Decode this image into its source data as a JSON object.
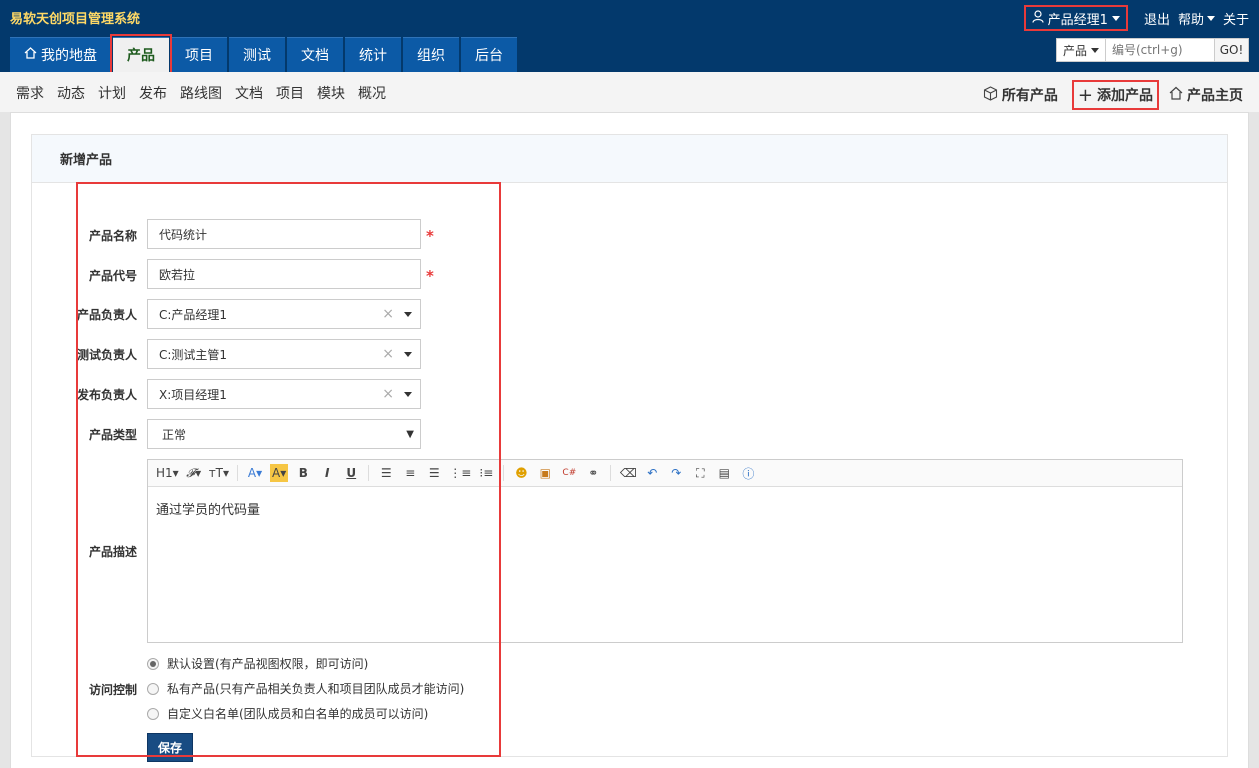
{
  "app": {
    "title": "易软天创项目管理系统"
  },
  "topnav": {
    "user": "产品经理1",
    "logout": "退出",
    "help": "帮助",
    "about": "关于"
  },
  "tabs": [
    {
      "label": "我的地盘",
      "icon": "home-icon"
    },
    {
      "label": "产品"
    },
    {
      "label": "项目"
    },
    {
      "label": "测试"
    },
    {
      "label": "文档"
    },
    {
      "label": "统计"
    },
    {
      "label": "组织"
    },
    {
      "label": "后台"
    }
  ],
  "search": {
    "scope": "产品",
    "placeholder": "编号(ctrl+g)",
    "go": "GO!"
  },
  "subnav": {
    "items": [
      "需求",
      "动态",
      "计划",
      "发布",
      "路线图",
      "文档",
      "项目",
      "模块",
      "概况"
    ],
    "all_products": "所有产品",
    "add_product": "添加产品",
    "product_home": "产品主页"
  },
  "form": {
    "title": "新增产品",
    "name_label": "产品名称",
    "name_value": "代码统计",
    "code_label": "产品代号",
    "code_value": "欧若拉",
    "po_label": "产品负责人",
    "po_value": "C:产品经理1",
    "qd_label": "测试负责人",
    "qd_value": "C:测试主管1",
    "rd_label": "发布负责人",
    "rd_value": "X:项目经理1",
    "type_label": "产品类型",
    "type_value": "正常",
    "desc_label": "产品描述",
    "desc_value": "通过学员的代码量",
    "acl_label": "访问控制",
    "acl_options": [
      "默认设置(有产品视图权限，即可访问)",
      "私有产品(只有产品相关负责人和项目团队成员才能访问)",
      "自定义白名单(团队成员和白名单的成员可以访问)"
    ],
    "acl_selected": 0,
    "save": "保存"
  },
  "toolbar_icons": [
    "heading-icon",
    "font-family-icon",
    "font-size-icon",
    "font-color-icon",
    "highlight-icon",
    "bold-icon",
    "italic-icon",
    "underline-icon",
    "align-left-icon",
    "align-center-icon",
    "align-right-icon",
    "ordered-list-icon",
    "unordered-list-icon",
    "emoticon-icon",
    "image-icon",
    "code-icon",
    "link-icon",
    "clear-format-icon",
    "undo-icon",
    "redo-icon",
    "fullscreen-icon",
    "source-icon",
    "help-icon"
  ],
  "colors": {
    "header": "#03396c",
    "tab": "#0c5aa6",
    "highlight": "#e83a3a",
    "save": "#184c83",
    "brand_title": "#ffd966"
  }
}
